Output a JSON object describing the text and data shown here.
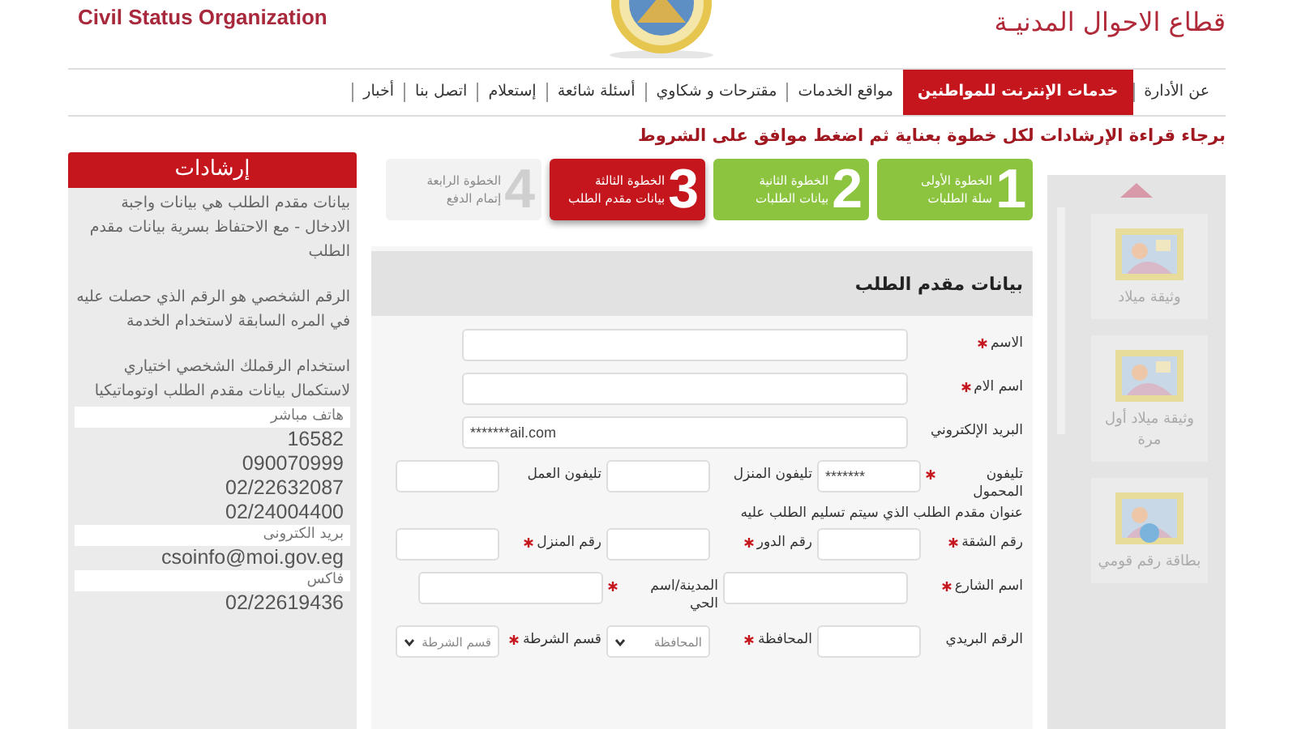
{
  "header": {
    "org_name_en": "Civil Status Organization",
    "org_name_ar": "قطاع الاحوال المدنيـة"
  },
  "nav": [
    {
      "label": "عن الأدارة",
      "selected": false
    },
    {
      "label": "خدمات الإنترنت للمواطنين",
      "selected": true
    },
    {
      "label": "مواقع الخدمات",
      "selected": false
    },
    {
      "label": "مقترحات و شكاوي",
      "selected": false
    },
    {
      "label": "أسئلة شائعة",
      "selected": false
    },
    {
      "label": "إستعلام",
      "selected": false
    },
    {
      "label": "اتصل بنا",
      "selected": false
    },
    {
      "label": "أخبار",
      "selected": false
    }
  ],
  "instruction": "برجاء قراءة الإرشادات لكل خطوة بعناية ثم اضغط موافق على الشروط",
  "steps": [
    {
      "number": "1",
      "title": "الخطوة الأولى",
      "subtitle": "سلة الطلبات",
      "completed": true,
      "selected": false
    },
    {
      "number": "2",
      "title": "الخطوة الثانية",
      "subtitle": "بيانات الطلبات",
      "completed": true,
      "selected": false
    },
    {
      "number": "3",
      "title": "الخطوة الثالثة",
      "subtitle": "بيانات مقدم الطلب",
      "completed": false,
      "selected": true
    },
    {
      "number": "4",
      "title": "الخطوة الرابعة",
      "subtitle": "إتمام الدفع",
      "completed": false,
      "selected": false
    }
  ],
  "form": {
    "title": "بيانات مقدم الطلب",
    "rows": [
      {
        "kind": "fields",
        "fields": [
          {
            "label": "الاسم",
            "required": true,
            "kind": "input"
          }
        ]
      },
      {
        "kind": "fields",
        "fields": [
          {
            "label": "اسم الام",
            "required": true,
            "kind": "input"
          }
        ]
      },
      {
        "kind": "fields",
        "fields": [
          {
            "label": "البريد الإلكتروني",
            "required": false,
            "kind": "input",
            "value": "*******ail.com"
          }
        ]
      },
      {
        "kind": "fields",
        "fields": [
          {
            "label": "تليفون المحمول",
            "required": true,
            "kind": "input",
            "value": "*******"
          },
          {
            "label": "تليفون المنزل",
            "required": false,
            "kind": "input"
          },
          {
            "label": "تليفون العمل",
            "required": false,
            "kind": "input"
          }
        ]
      },
      {
        "kind": "note",
        "text": "عنوان مقدم الطلب الذي سيتم تسليم الطلب عليه"
      },
      {
        "kind": "fields",
        "fields": [
          {
            "label": "رقم الشقة",
            "required": true,
            "kind": "input"
          },
          {
            "label": "رقم الدور",
            "required": true,
            "kind": "input"
          },
          {
            "label": "رقم المنزل",
            "required": true,
            "kind": "input"
          }
        ]
      },
      {
        "kind": "fields",
        "fields": [
          {
            "label": "اسم الشارع",
            "required": true,
            "kind": "input"
          },
          {
            "label": "المدينة/اسم الحي",
            "required": true,
            "kind": "input"
          }
        ]
      },
      {
        "kind": "fields",
        "fields": [
          {
            "label": "الرقم البريدي",
            "required": false,
            "kind": "input"
          },
          {
            "label": "المحافظة",
            "required": true,
            "kind": "select",
            "value": "المحافظة"
          },
          {
            "label": "قسم الشرطة",
            "required": true,
            "kind": "select",
            "value": "قسم الشرطة"
          }
        ]
      }
    ]
  },
  "guidance": {
    "title": "إرشادات",
    "paragraphs": [
      "بيانات مقدم الطلب هي بيانات واجبة الادخال - مع الاحتفاظ بسرية بيانات مقدم الطلب",
      "الرقم الشخصي هو الرقم الذي حصلت عليه في المره السابقة لاستخدام الخدمة",
      "استخدام الرقملك الشخصي اختياري لاستكمال بيانات مقدم الطلب اوتوماتيكيا"
    ],
    "contacts": [
      {
        "label": "هاتف مباشر",
        "values": [
          "16582",
          "090070999",
          "02/22632087",
          "02/24004400"
        ]
      },
      {
        "label": "بريد الكترونى",
        "values": [
          "csoinfo@moi.gov.eg"
        ]
      },
      {
        "label": "فاكس",
        "values": [
          "02/22619436"
        ]
      }
    ]
  },
  "services": [
    {
      "label": "وثيقة ميلاد"
    },
    {
      "label": "وثيقة ميلاد أول مرة"
    },
    {
      "label": "بطاقة رقم قومي"
    }
  ]
}
